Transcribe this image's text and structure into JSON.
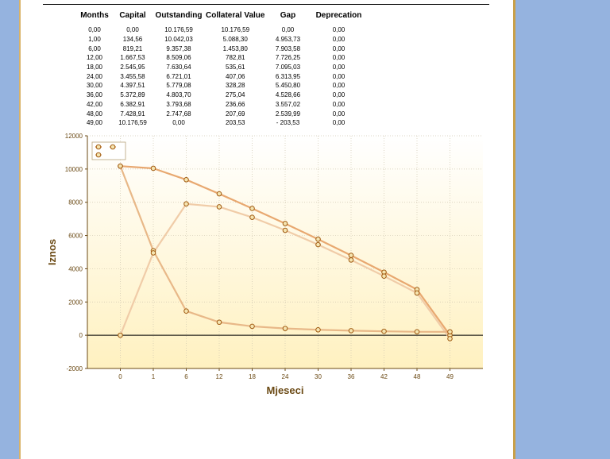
{
  "table": {
    "headers": [
      "Months",
      "Capital",
      "Outstanding",
      "Collateral Value",
      "Gap",
      "Deprecation"
    ],
    "rows": [
      [
        "0,00",
        "0,00",
        "10.176,59",
        "10.176,59",
        "0,00",
        "0,00"
      ],
      [
        "1,00",
        "134,56",
        "10.042,03",
        "5.088,30",
        "4.953,73",
        "0,00"
      ],
      [
        "6,00",
        "819,21",
        "9.357,38",
        "1.453,80",
        "7.903,58",
        "0,00"
      ],
      [
        "12,00",
        "1.667,53",
        "8.509,06",
        "782,81",
        "7.726,25",
        "0,00"
      ],
      [
        "18,00",
        "2.545,95",
        "7.630,64",
        "535,61",
        "7.095,03",
        "0,00"
      ],
      [
        "24,00",
        "3.455,58",
        "6.721,01",
        "407,06",
        "6.313,95",
        "0,00"
      ],
      [
        "30,00",
        "4.397,51",
        "5.779,08",
        "328,28",
        "5.450,80",
        "0,00"
      ],
      [
        "36,00",
        "5.372,89",
        "4.803,70",
        "275,04",
        "4.528,66",
        "0,00"
      ],
      [
        "42,00",
        "6.382,91",
        "3.793,68",
        "236,66",
        "3.557,02",
        "0,00"
      ],
      [
        "48,00",
        "7.428,91",
        "2.747,68",
        "207,69",
        "2.539,99",
        "0,00"
      ],
      [
        "49,00",
        "10.176,59",
        "0,00",
        "203,53",
        "- 203,53",
        "0,00"
      ]
    ]
  },
  "chart_data": {
    "type": "line",
    "categories": [
      "0",
      "1",
      "6",
      "12",
      "18",
      "24",
      "30",
      "36",
      "42",
      "48",
      "49"
    ],
    "series": [
      {
        "values": [
          10176.59,
          10042.03,
          9357.38,
          8509.06,
          7630.64,
          6721.01,
          5779.08,
          4803.7,
          3793.68,
          2747.68,
          0.0
        ],
        "color": "#e8a870"
      },
      {
        "values": [
          10176.59,
          5088.3,
          1453.8,
          782.81,
          535.61,
          407.06,
          328.28,
          275.04,
          236.66,
          207.69,
          203.53
        ],
        "color": "#e8b888"
      },
      {
        "values": [
          0.0,
          4953.73,
          7903.58,
          7726.25,
          7095.03,
          6313.95,
          5450.8,
          4528.66,
          3557.02,
          2539.99,
          -203.53
        ],
        "color": "#f0cca8"
      }
    ],
    "xlabel": "Mjeseci",
    "ylabel": "Iznos",
    "ylim": [
      -2000,
      12000
    ],
    "yticks": [
      -2000,
      0,
      2000,
      4000,
      6000,
      8000,
      10000,
      12000
    ],
    "grid": true,
    "legend_position": "top-left",
    "colors": {
      "axis": "#6b4a15",
      "marker_fill": "#f5e4b0",
      "marker_stroke": "#a05a10",
      "plot_top": "#ffffff",
      "plot_bottom": "#fff1c0"
    }
  }
}
